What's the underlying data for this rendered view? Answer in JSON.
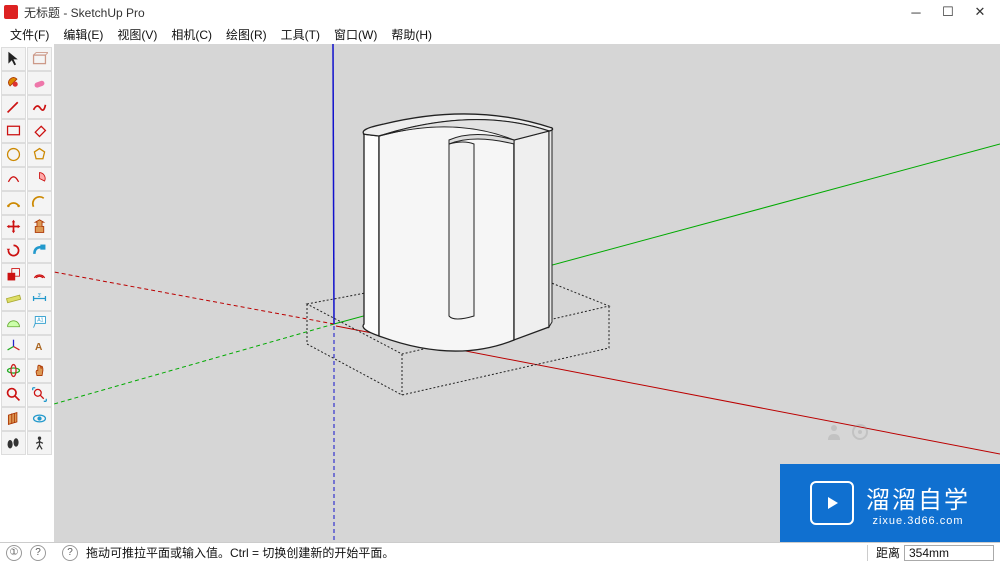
{
  "window": {
    "title": "无标题 - SketchUp Pro"
  },
  "menu": {
    "items": [
      {
        "label": "文件(F)",
        "name": "menu-file"
      },
      {
        "label": "编辑(E)",
        "name": "menu-edit"
      },
      {
        "label": "视图(V)",
        "name": "menu-view"
      },
      {
        "label": "相机(C)",
        "name": "menu-camera"
      },
      {
        "label": "绘图(R)",
        "name": "menu-draw"
      },
      {
        "label": "工具(T)",
        "name": "menu-tools"
      },
      {
        "label": "窗口(W)",
        "name": "menu-window"
      },
      {
        "label": "帮助(H)",
        "name": "menu-help"
      }
    ]
  },
  "status": {
    "hint": "拖动可推拉平面或输入值。Ctrl = 切换创建新的开始平面。",
    "distance_label": "距离",
    "distance_value": "354mm"
  },
  "watermark": {
    "brand": "溜溜自学",
    "domain": "zixue.3d66.com"
  },
  "toolbar_rows": [
    [
      "select",
      "component"
    ],
    [
      "paint",
      "eraser"
    ],
    [
      "line",
      "freehand"
    ],
    [
      "rect",
      "rotrect"
    ],
    [
      "circle",
      "polygon"
    ],
    [
      "arc",
      "pie"
    ],
    [
      "arc2",
      "curve"
    ],
    [
      "move",
      "pushpull"
    ],
    [
      "rotate",
      "followme"
    ],
    [
      "scale",
      "offset"
    ],
    [
      "tape",
      "dim"
    ],
    [
      "protractor",
      "text"
    ],
    [
      "axes",
      "3dtext"
    ],
    [
      "orbit",
      "pan"
    ],
    [
      "zoom",
      "zoomext"
    ],
    [
      "section",
      "lookaround"
    ],
    [
      "walk",
      "position"
    ]
  ]
}
